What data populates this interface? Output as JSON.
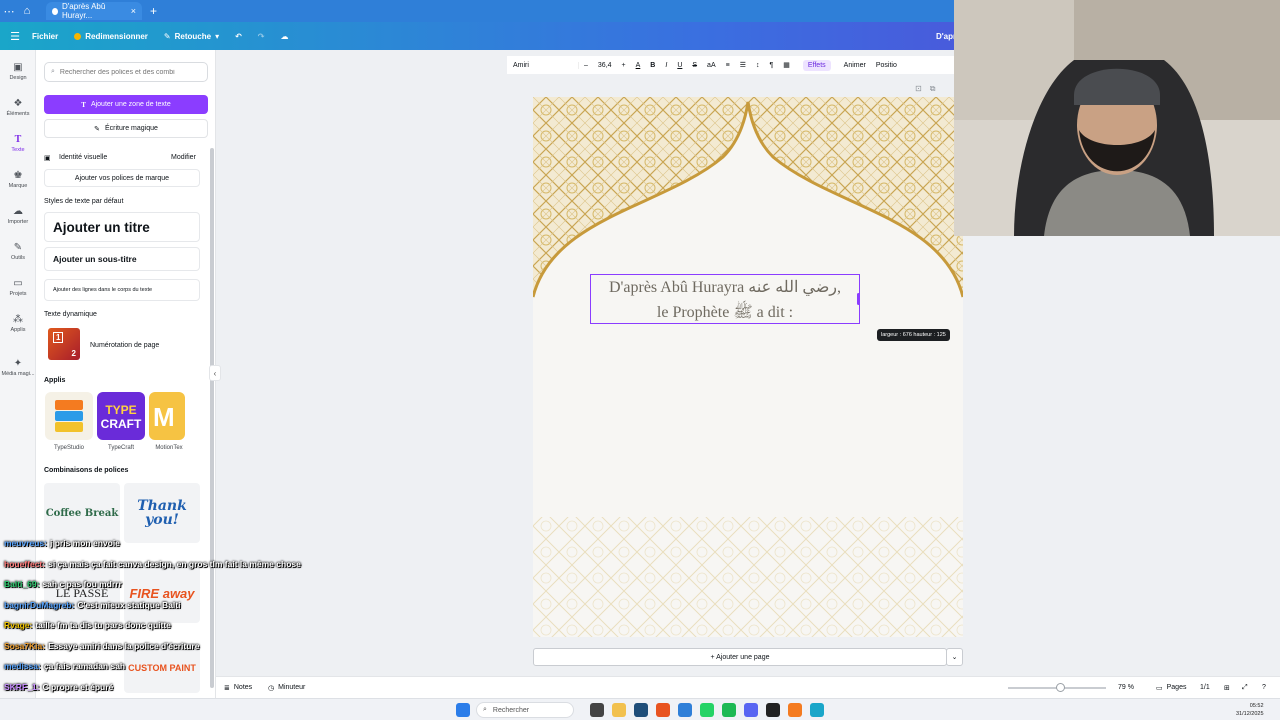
{
  "browser": {
    "tab_title": "D'après Abû Hurayr...",
    "tab_close": "×",
    "new_tab": "+"
  },
  "topbar": {
    "menu": "Fichier",
    "resize": "Redimensionner",
    "edit_mode": "Retouche",
    "doc_title_right": "D'apr"
  },
  "rail": [
    {
      "label": "Design",
      "icon": "design-icon"
    },
    {
      "label": "Éléments",
      "icon": "elements-icon"
    },
    {
      "label": "Texte",
      "icon": "text-icon"
    },
    {
      "label": "Marque",
      "icon": "brand-icon"
    },
    {
      "label": "Importer",
      "icon": "upload-icon"
    },
    {
      "label": "Outils",
      "icon": "tools-icon"
    },
    {
      "label": "Projets",
      "icon": "folder-icon"
    },
    {
      "label": "Applis",
      "icon": "apps-icon"
    },
    {
      "label": "Média magi...",
      "icon": "magic-media-icon"
    }
  ],
  "panel": {
    "search_placeholder": "Rechercher des polices et des combi",
    "add_textbox": "Ajouter une zone de texte",
    "magic_write": "Écriture magique",
    "brand_identity": "Identité visuelle",
    "modify": "Modifier",
    "add_brand_fonts": "Ajouter vos polices de marque",
    "default_styles": "Styles de texte par défaut",
    "add_title": "Ajouter un titre",
    "add_subtitle": "Ajouter un sous-titre",
    "add_body": "Ajouter des lignes dans le corps du texte",
    "dynamic_text": "Texte dynamique",
    "page_numbering": "Numérotation de page",
    "apps_heading": "Applis",
    "apps": [
      "TypeStudio",
      "TypeCraft",
      "MotionTex"
    ],
    "font_combos": "Combinaisons de polices",
    "combo_labels": [
      "Coffee Break",
      "Thank you!",
      "FIRE away",
      "LE PASSÉ",
      "CUSTOM PAINT"
    ]
  },
  "format_toolbar": {
    "font": "Amiri",
    "minus": "–",
    "size": "36,4",
    "plus": "+",
    "effects": "Effets",
    "animate": "Animer",
    "position": "Positio"
  },
  "canvas": {
    "line1": "D'après Abû Hurayra رضي الله عنه,",
    "line2": "le Prophète ﷺ a dit :",
    "size_tooltip": "largeur : 676 hauteur : 125",
    "add_page": "+ Ajouter une page"
  },
  "bottombar": {
    "notes": "Notes",
    "timer": "Minuteur",
    "zoom": "79 %",
    "pages": "Pages",
    "page_count": "1/1"
  },
  "taskbar": {
    "search": "Rechercher",
    "time": "05:52",
    "date": "31/12/2025"
  },
  "chat": [
    {
      "user": "meuvreus:",
      "msg": "j pris mon envoie",
      "color": "#5aa6ff"
    },
    {
      "user": "houeffect:",
      "msg": "si ça mais ça fait canva design, en gros tlm fait la même chose",
      "color": "#ff7a7a"
    },
    {
      "user": "Balti_69:",
      "msg": "sah c pas fou mdrrr",
      "color": "#2ecc71"
    },
    {
      "user": "bagnirDuMagreb:",
      "msg": "C'est mieux statique Balti",
      "color": "#5aa6ff"
    },
    {
      "user": "Rvage:",
      "msg": "taille fm ta dis tu pars donc quitte",
      "color": "#f0c400"
    },
    {
      "user": "Sosa7Kia:",
      "msg": "Essaye amiri dans la police d'écriture",
      "color": "#f0a030"
    },
    {
      "user": "medissa:",
      "msg": "ça fais ramadan sah",
      "color": "#5aa6ff"
    },
    {
      "user": "SKRF_1:",
      "msg": "C propre et épuré",
      "color": "#c78cff"
    }
  ]
}
